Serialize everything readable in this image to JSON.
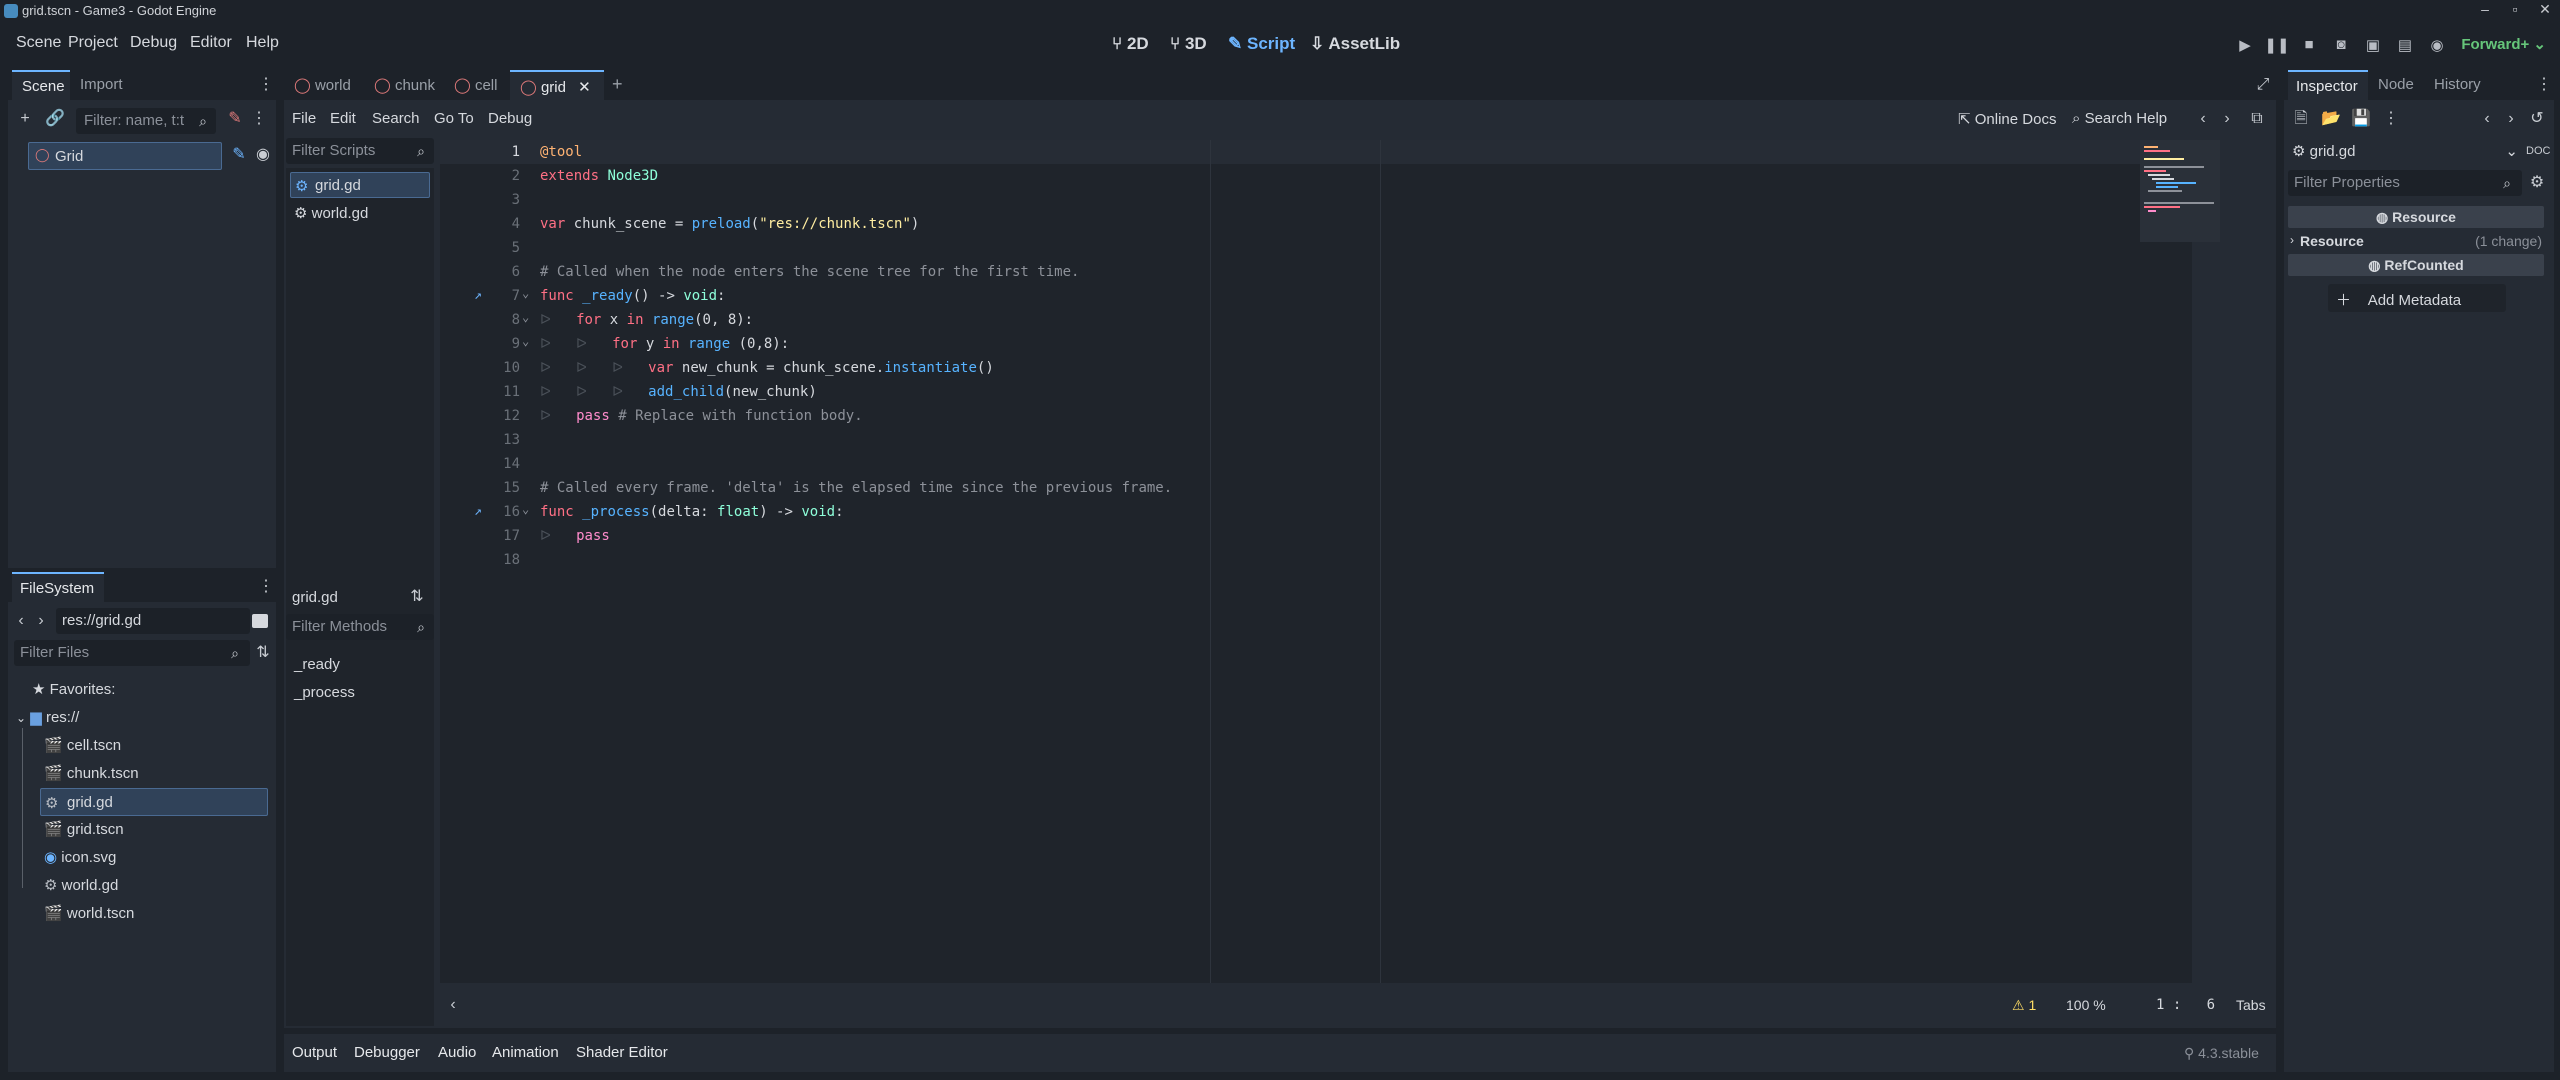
{
  "window": {
    "title": "grid.tscn - Game3 - Godot Engine"
  },
  "menu": [
    "Scene",
    "Project",
    "Debug",
    "Editor",
    "Help"
  ],
  "workspaces": {
    "w2d": "2D",
    "w3d": "3D",
    "script": "Script",
    "assetlib": "AssetLib",
    "active": "Script"
  },
  "renderer": "Forward+",
  "scene_dock": {
    "tabs": [
      "Scene",
      "Import"
    ],
    "filter_placeholder": "Filter: name, t:t",
    "root_node": "Grid"
  },
  "filesystem_dock": {
    "tab": "FileSystem",
    "path": "res://grid.gd",
    "filter_placeholder": "Filter Files",
    "favorites": "Favorites:",
    "root": "res://",
    "files": [
      {
        "name": "cell.tscn",
        "icon": "scene-icon"
      },
      {
        "name": "chunk.tscn",
        "icon": "scene-icon"
      },
      {
        "name": "grid.gd",
        "icon": "gear-icon",
        "selected": true
      },
      {
        "name": "grid.tscn",
        "icon": "scene-icon"
      },
      {
        "name": "icon.svg",
        "icon": "image-icon"
      },
      {
        "name": "world.gd",
        "icon": "gear-icon"
      },
      {
        "name": "world.tscn",
        "icon": "scene-icon"
      }
    ]
  },
  "script_editor": {
    "tabs": [
      "world",
      "chunk",
      "cell",
      "grid"
    ],
    "active_tab": "grid",
    "menus": [
      "File",
      "Edit",
      "Search",
      "Go To",
      "Debug"
    ],
    "online_docs": "Online Docs",
    "search_help": "Search Help",
    "filter_scripts": "Filter Scripts",
    "scripts": [
      "grid.gd",
      "world.gd"
    ],
    "current_script": "grid.gd",
    "filter_methods": "Filter Methods",
    "methods": [
      "_ready",
      "_process"
    ],
    "status": {
      "warnings": "1",
      "zoom": "100 %",
      "line": "1",
      "col": "6",
      "indent": "Tabs"
    }
  },
  "code_lines": [
    "@tool",
    "extends Node3D",
    "",
    "var chunk_scene = preload(\"res://chunk.tscn\")",
    "",
    "# Called when the node enters the scene tree for the first time.",
    "func _ready() -> void:",
    "for x in range(0, 8):",
    "for y in range (0,8):",
    "var new_chunk = chunk_scene.instantiate()",
    "add_child(new_chunk)",
    "pass # Replace with function body.",
    "",
    "",
    "# Called every frame. 'delta' is the elapsed time since the previous frame.",
    "func _process(delta: float) -> void:",
    "pass",
    ""
  ],
  "bottom_panel": {
    "tabs": [
      "Output",
      "Debugger",
      "Audio",
      "Animation",
      "Shader Editor"
    ],
    "version": "4.3.stable"
  },
  "inspector": {
    "tabs": [
      "Inspector",
      "Node",
      "History"
    ],
    "object": "grid.gd",
    "filter_placeholder": "Filter Properties",
    "resource_header": "Resource",
    "resource_section": "Resource",
    "resource_changes": "(1 change)",
    "refcounted_header": "RefCounted",
    "add_metadata": "Add Metadata"
  },
  "colors": {
    "accent": "#6db5ff",
    "background": "#1d2229",
    "panel": "#252b34",
    "editor_bg": "#1f242b",
    "renderer": "#66c67a"
  }
}
